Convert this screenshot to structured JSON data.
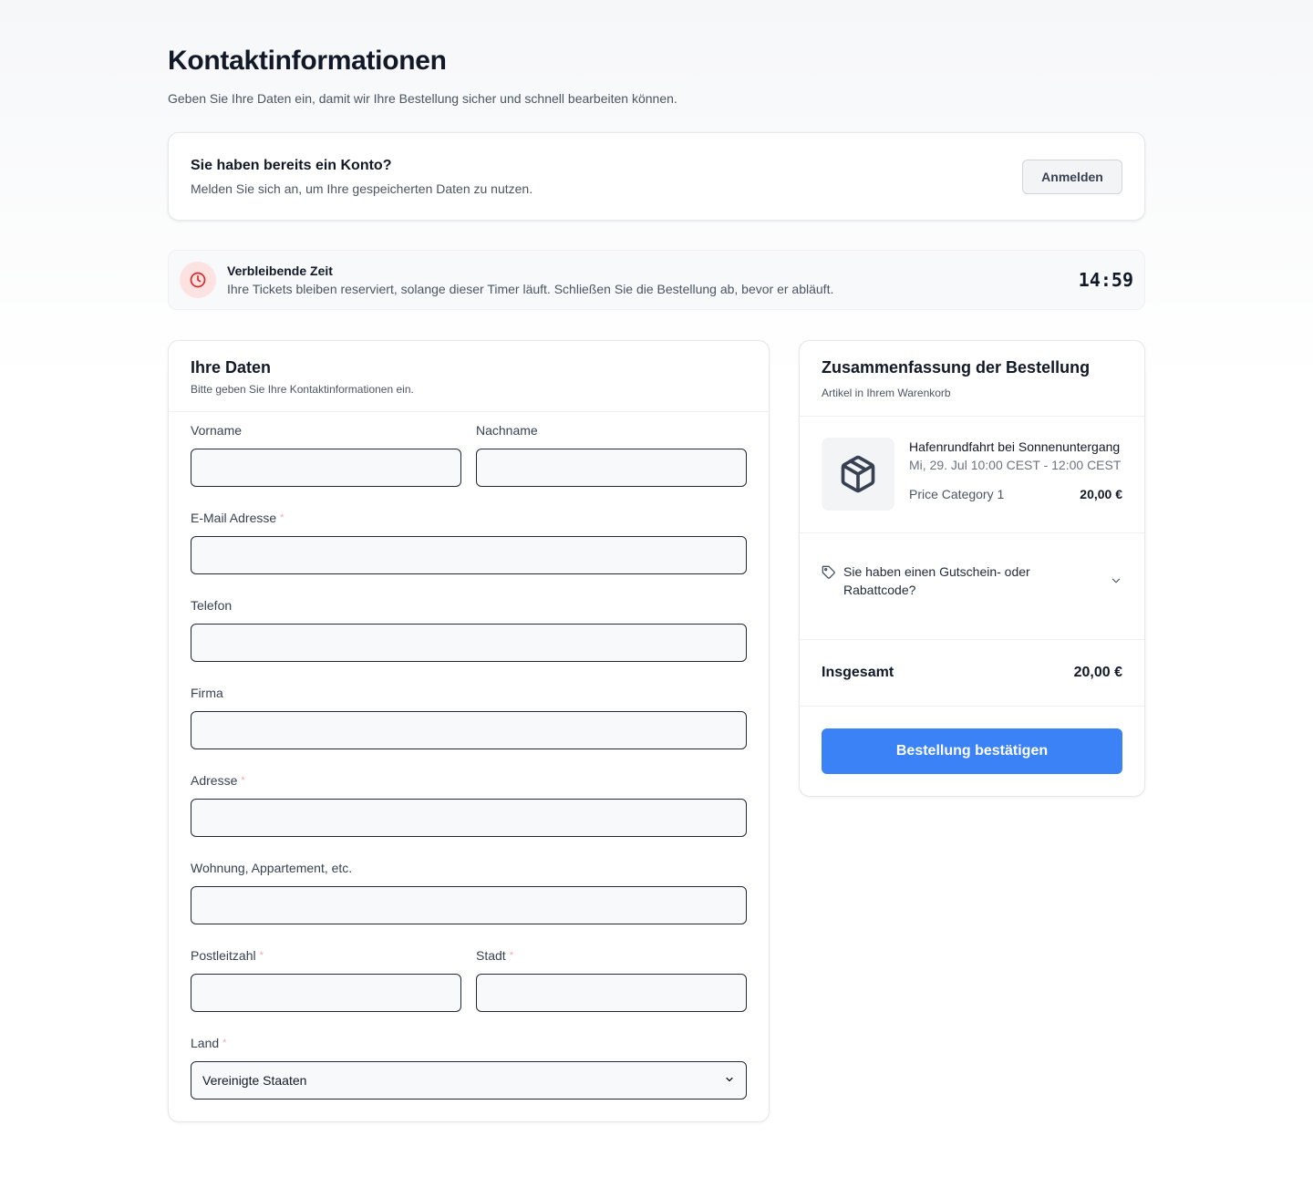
{
  "header": {
    "title": "Kontaktinformationen",
    "subtitle": "Geben Sie Ihre Daten ein, damit wir Ihre Bestellung sicher und schnell bearbeiten können."
  },
  "account": {
    "title": "Sie haben bereits ein Konto?",
    "text": "Melden Sie sich an, um Ihre gespeicherten Daten zu nutzen.",
    "login_label": "Anmelden"
  },
  "timer": {
    "title": "Verbleibende Zeit",
    "description": "Ihre Tickets bleiben reserviert, solange dieser Timer läuft. Schließen Sie die Bestellung ab, bevor er abläuft.",
    "value": "14:59",
    "icon": "clock-icon",
    "accent_color": "#dc2626"
  },
  "form": {
    "title": "Ihre Daten",
    "subtitle": "Bitte geben Sie Ihre Kontaktinformationen ein.",
    "required_marker": "*",
    "fields": {
      "first_name": {
        "label": "Vorname",
        "value": ""
      },
      "last_name": {
        "label": "Nachname",
        "value": ""
      },
      "email": {
        "label": "E-Mail Adresse",
        "value": ""
      },
      "phone": {
        "label": "Telefon",
        "value": ""
      },
      "company": {
        "label": "Firma",
        "value": ""
      },
      "address": {
        "label": "Adresse",
        "value": ""
      },
      "address2": {
        "label": "Wohnung, Appartement, etc.",
        "value": ""
      },
      "zip": {
        "label": "Postleitzahl",
        "value": ""
      },
      "city": {
        "label": "Stadt",
        "value": ""
      },
      "country": {
        "label": "Land",
        "value": "Vereinigte Staaten"
      }
    }
  },
  "summary": {
    "title": "Zusammenfassung der Bestellung",
    "subtitle": "Artikel in Ihrem Warenkorb",
    "item": {
      "icon": "package-icon",
      "name": "Hafenrundfahrt bei Sonnenuntergang",
      "date": "Mi, 29. Jul 10:00 CEST - 12:00 CEST",
      "category": "Price Category 1",
      "price": "20,00 €"
    },
    "voucher_label": "Sie haben einen Gutschein- oder Rabattcode?",
    "total_label": "Insgesamt",
    "total_value": "20,00 €",
    "confirm_label": "Bestellung bestätigen",
    "confirm_color": "#3b82f6"
  }
}
